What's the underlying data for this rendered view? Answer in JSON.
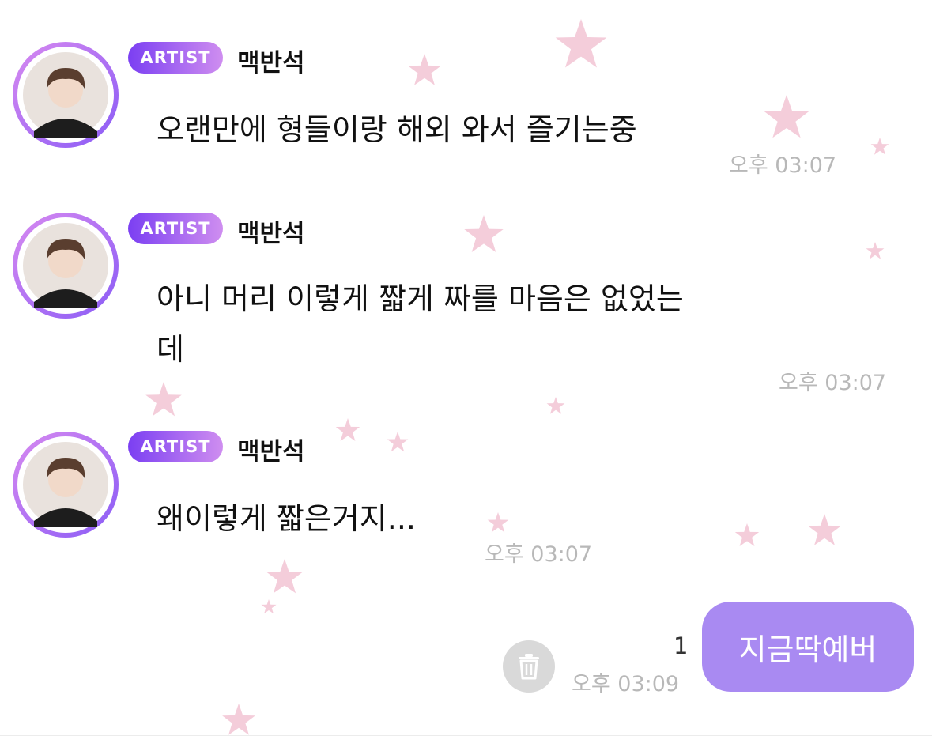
{
  "chat": {
    "messages": [
      {
        "badge": "ARTIST",
        "sender": "맥반석",
        "text": "오랜만에 형들이랑 해외 와서 즐기는중",
        "time": "오후 03:07"
      },
      {
        "badge": "ARTIST",
        "sender": "맥반석",
        "text_line1": "아니 머리 이렇게 짧게 짜를 마음은 없었는",
        "text_line2": "데",
        "time": "오후 03:07"
      },
      {
        "badge": "ARTIST",
        "sender": "맥반석",
        "text": "왜이렇게 짧은거지...",
        "time": "오후 03:07"
      }
    ],
    "my_message": {
      "text": "지금딱예버",
      "unread_count": "1",
      "time": "오후 03:09"
    }
  },
  "colors": {
    "badge_gradient_start": "#7b3ff2",
    "badge_gradient_end": "#cf8ef0",
    "my_bubble": "#a98af2",
    "timestamp": "#b8b8b8",
    "star": "#f2c4d4"
  },
  "icons": {
    "avatar": "avatar-person-icon",
    "trash": "trash-icon",
    "background": "star-icon"
  }
}
